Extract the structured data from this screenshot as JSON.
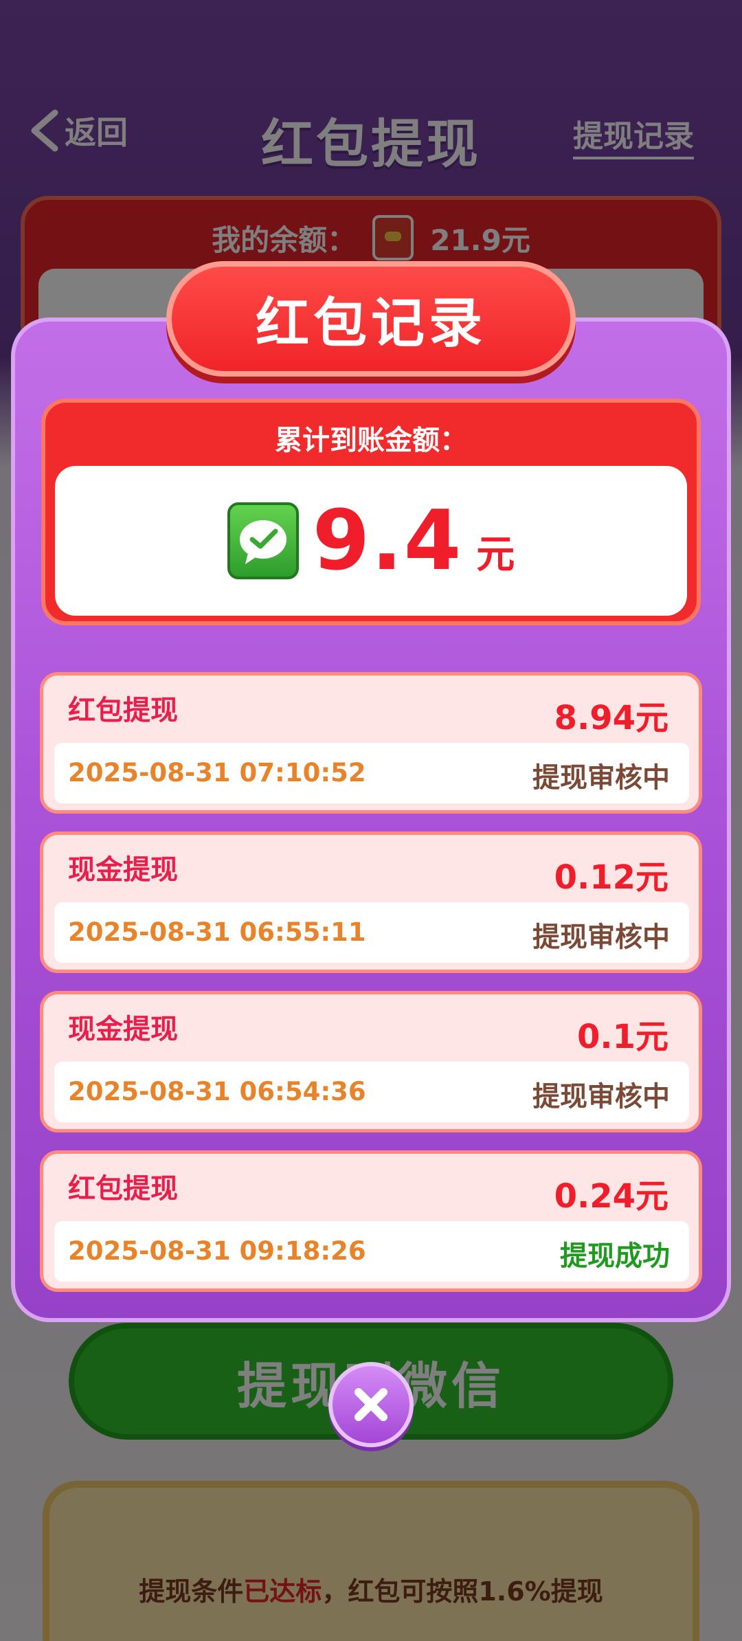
{
  "header": {
    "back_label": "返回",
    "title": "红包提现",
    "records_link": "提现记录"
  },
  "balance": {
    "label": "我的余额：",
    "value": "21.9元"
  },
  "withdraw_button": {
    "label": "提现到微信"
  },
  "condition": {
    "prefix": "提现条件",
    "highlight": "已达标",
    "suffix": "，红包可按照1.6%提现"
  },
  "modal": {
    "title": "红包记录",
    "total_label": "累计到账金额：",
    "total_amount": "9.4",
    "total_unit": "元",
    "records": [
      {
        "type": "红包提现",
        "amount": "8.94元",
        "time": "2025-08-31 07:10:52",
        "status": "提现审核中",
        "status_kind": "pending"
      },
      {
        "type": "现金提现",
        "amount": "0.12元",
        "time": "2025-08-31 06:55:11",
        "status": "提现审核中",
        "status_kind": "pending"
      },
      {
        "type": "现金提现",
        "amount": "0.1元",
        "time": "2025-08-31 06:54:36",
        "status": "提现审核中",
        "status_kind": "pending"
      },
      {
        "type": "红包提现",
        "amount": "0.24元",
        "time": "2025-08-31 09:18:26",
        "status": "提现成功",
        "status_kind": "success"
      }
    ]
  },
  "icons": {
    "back": "chevron-left-icon",
    "balance": "red-envelope-icon",
    "wechat": "wechat-icon",
    "close": "close-icon"
  },
  "colors": {
    "accent_red": "#f01e2a",
    "modal_purple": "#a74fd6",
    "success_green": "#1f9a1f",
    "pending_brown": "#7b4a36"
  }
}
